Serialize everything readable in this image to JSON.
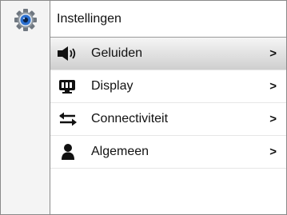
{
  "header": {
    "title": "Instellingen"
  },
  "menu": {
    "items": [
      {
        "label": "Geluiden",
        "icon": "speaker-icon",
        "chevron": ">",
        "selected": true
      },
      {
        "label": "Display",
        "icon": "monitor-icon",
        "chevron": ">",
        "selected": false
      },
      {
        "label": "Connectiviteit",
        "icon": "arrows-icon",
        "chevron": ">",
        "selected": false
      },
      {
        "label": "Algemeen",
        "icon": "person-icon",
        "chevron": ">",
        "selected": false
      }
    ]
  },
  "colors": {
    "gear_accent": "#2a6fd0",
    "selected_bg": "#dcdcdc",
    "border": "#8a8a8a"
  }
}
